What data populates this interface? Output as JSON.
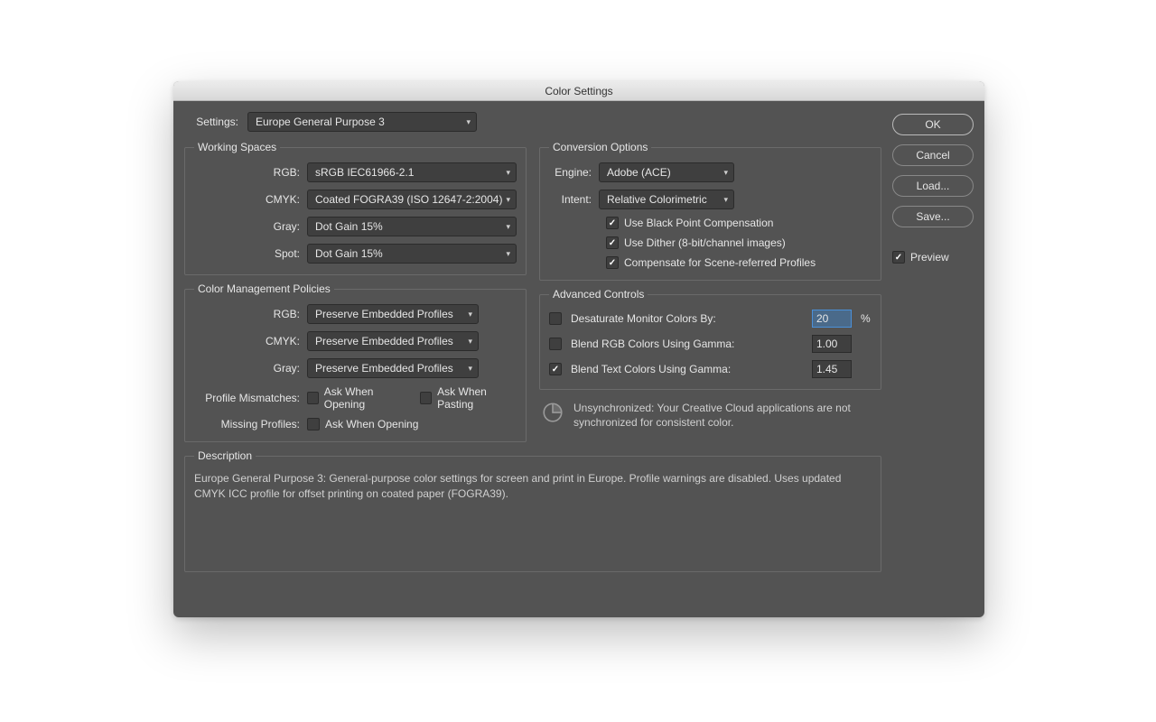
{
  "title": "Color Settings",
  "settings_label": "Settings:",
  "settings_value": "Europe General Purpose 3",
  "working_spaces": {
    "legend": "Working Spaces",
    "rgb_label": "RGB:",
    "rgb_value": "sRGB IEC61966-2.1",
    "cmyk_label": "CMYK:",
    "cmyk_value": "Coated FOGRA39 (ISO 12647-2:2004)",
    "gray_label": "Gray:",
    "gray_value": "Dot Gain 15%",
    "spot_label": "Spot:",
    "spot_value": "Dot Gain 15%"
  },
  "policies": {
    "legend": "Color Management Policies",
    "rgb_label": "RGB:",
    "rgb_value": "Preserve Embedded Profiles",
    "cmyk_label": "CMYK:",
    "cmyk_value": "Preserve Embedded Profiles",
    "gray_label": "Gray:",
    "gray_value": "Preserve Embedded Profiles",
    "mismatch_label": "Profile Mismatches:",
    "mismatch_open": "Ask When Opening",
    "mismatch_paste": "Ask When Pasting",
    "missing_label": "Missing Profiles:",
    "missing_open": "Ask When Opening"
  },
  "conversion": {
    "legend": "Conversion Options",
    "engine_label": "Engine:",
    "engine_value": "Adobe (ACE)",
    "intent_label": "Intent:",
    "intent_value": "Relative Colorimetric",
    "bpc": "Use Black Point Compensation",
    "dither": "Use Dither (8-bit/channel images)",
    "scene": "Compensate for Scene-referred Profiles"
  },
  "advanced": {
    "legend": "Advanced Controls",
    "desat_label": "Desaturate Monitor Colors By:",
    "desat_value": "20",
    "desat_unit": "%",
    "blend_rgb_label": "Blend RGB Colors Using Gamma:",
    "blend_rgb_value": "1.00",
    "blend_text_label": "Blend Text Colors Using Gamma:",
    "blend_text_value": "1.45"
  },
  "sync_text": "Unsynchronized: Your Creative Cloud applications are not synchronized for consistent color.",
  "description": {
    "legend": "Description",
    "text": "Europe General Purpose 3:  General-purpose color settings for screen and print in Europe. Profile warnings are disabled. Uses updated CMYK ICC profile for offset printing on coated paper (FOGRA39)."
  },
  "buttons": {
    "ok": "OK",
    "cancel": "Cancel",
    "load": "Load...",
    "save": "Save..."
  },
  "preview_label": "Preview"
}
